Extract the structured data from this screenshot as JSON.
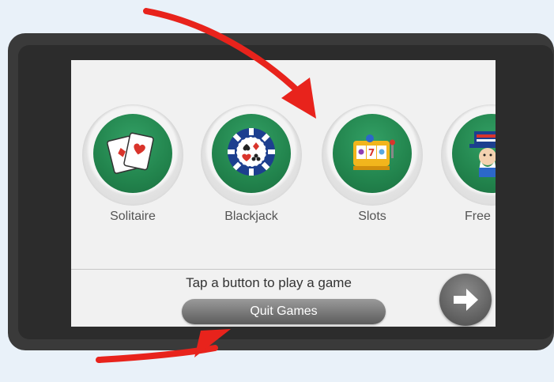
{
  "games": [
    {
      "label": "Solitaire",
      "icon": "playing-cards-icon"
    },
    {
      "label": "Blackjack",
      "icon": "poker-chip-icon"
    },
    {
      "label": "Slots",
      "icon": "slot-machine-icon"
    },
    {
      "label": "Free",
      "icon": "uncle-sam-icon"
    }
  ],
  "footer": {
    "hint": "Tap a button to play a game",
    "quit_label": "Quit Games",
    "next_icon": "arrow-right-icon"
  },
  "colors": {
    "tile_green": "#22844d",
    "annotation_red": "#e8231c",
    "background": "#e9f1f9"
  }
}
